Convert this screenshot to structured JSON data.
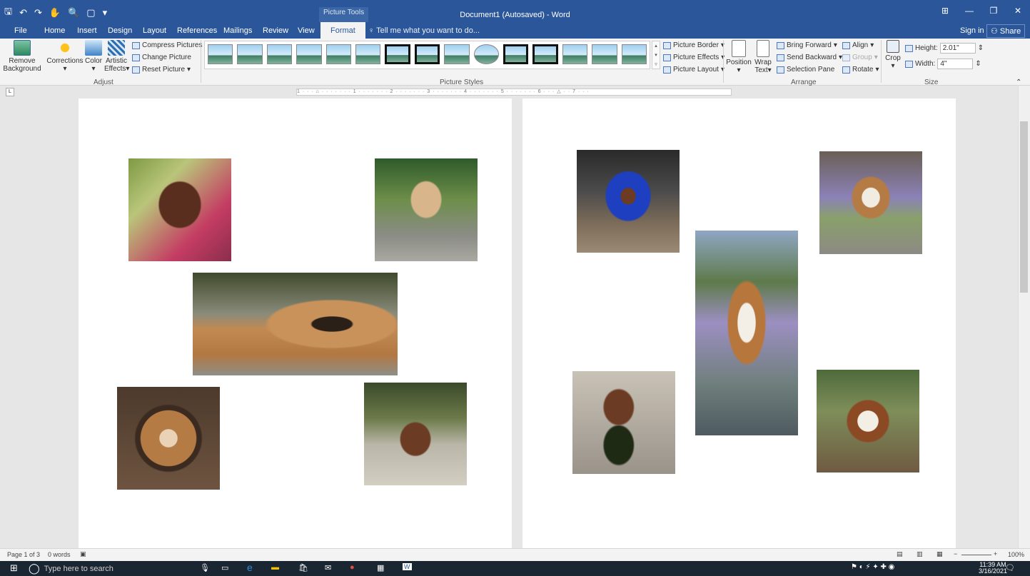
{
  "titlebar": {
    "picture_tools": "Picture Tools",
    "doc_title": "Document1 (Autosaved) - Word",
    "qat_icons": [
      "save-icon",
      "undo-icon",
      "redo-icon",
      "touch-mode-icon",
      "print-preview-icon",
      "new-doc-icon",
      "customize-qat-icon"
    ],
    "window_controls": [
      "ribbon-display-icon",
      "minimize-icon",
      "restore-icon",
      "close-icon"
    ]
  },
  "tabs": {
    "items": [
      "File",
      "Home",
      "Insert",
      "Design",
      "Layout",
      "References",
      "Mailings",
      "Review",
      "View",
      "Format"
    ],
    "active": "Format",
    "tell_me": "Tell me what you want to do...",
    "sign_in": "Sign in",
    "share": "Share"
  },
  "ribbon": {
    "adjust": {
      "label": "Adjust",
      "remove_bg_1": "Remove",
      "remove_bg_2": "Background",
      "corrections": "Corrections",
      "color": "Color",
      "artistic_1": "Artistic",
      "artistic_2": "Effects",
      "compress": "Compress Pictures",
      "change": "Change Picture",
      "reset": "Reset Picture"
    },
    "styles": {
      "label": "Picture Styles",
      "border": "Picture Border",
      "effects": "Picture Effects",
      "layout": "Picture Layout"
    },
    "arrange": {
      "label": "Arrange",
      "position": "Position",
      "wrap_1": "Wrap",
      "wrap_2": "Text",
      "bring_forward": "Bring Forward",
      "send_backward": "Send Backward",
      "selection_pane": "Selection Pane",
      "align": "Align",
      "group": "Group",
      "rotate": "Rotate"
    },
    "size": {
      "label": "Size",
      "crop": "Crop",
      "height_label": "Height:",
      "height_value": "2.01\"",
      "width_label": "Width:",
      "width_value": "4\""
    }
  },
  "ruler": {
    "text": "1 · · · ⌂ · · · · · · · 1 · · · · · · · 2 · · · · · · · 3 · · · · · · · 4 · · · · · · · 5 · · · · · · · 6 · · · △ · · 7 · · ·"
  },
  "status": {
    "page": "Page 1 of 3",
    "words": "0 words",
    "zoom": "100%"
  },
  "taskbar": {
    "search_placeholder": "Type here to search",
    "time": "11:39 AM",
    "date": "3/16/2021"
  },
  "colors": {
    "accent": "#2b579a",
    "ribbon_bg": "#f3f3f3",
    "taskbar_bg": "#1b2633"
  }
}
